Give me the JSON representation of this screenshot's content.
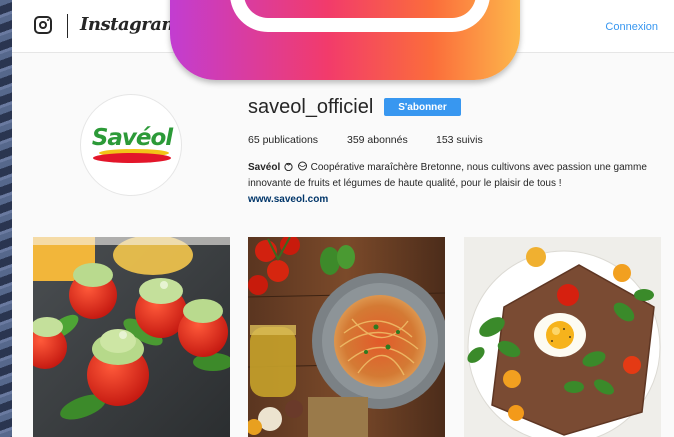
{
  "header": {
    "wordmark": "Instagram",
    "login_label": "Connexion"
  },
  "profile": {
    "username": "saveol_officiel",
    "follow_label": "S'abonner",
    "avatar_brand": "Savéol",
    "stats": {
      "publications": "65 publications",
      "followers": "359 abonnés",
      "following": "153 suivis"
    },
    "bio": {
      "name": "Savéol",
      "text": "Coopérative maraîchère Bretonne, nous cultivons avec passion une gamme innovante de fruits et légumes de haute qualité, pour le plaisir de tous !",
      "website": "www.saveol.com"
    }
  },
  "posts": [
    {
      "icon": "stuffed-tomatoes-photo"
    },
    {
      "icon": "spaghetti-tomato-photo"
    },
    {
      "icon": "galette-egg-photo"
    }
  ]
}
